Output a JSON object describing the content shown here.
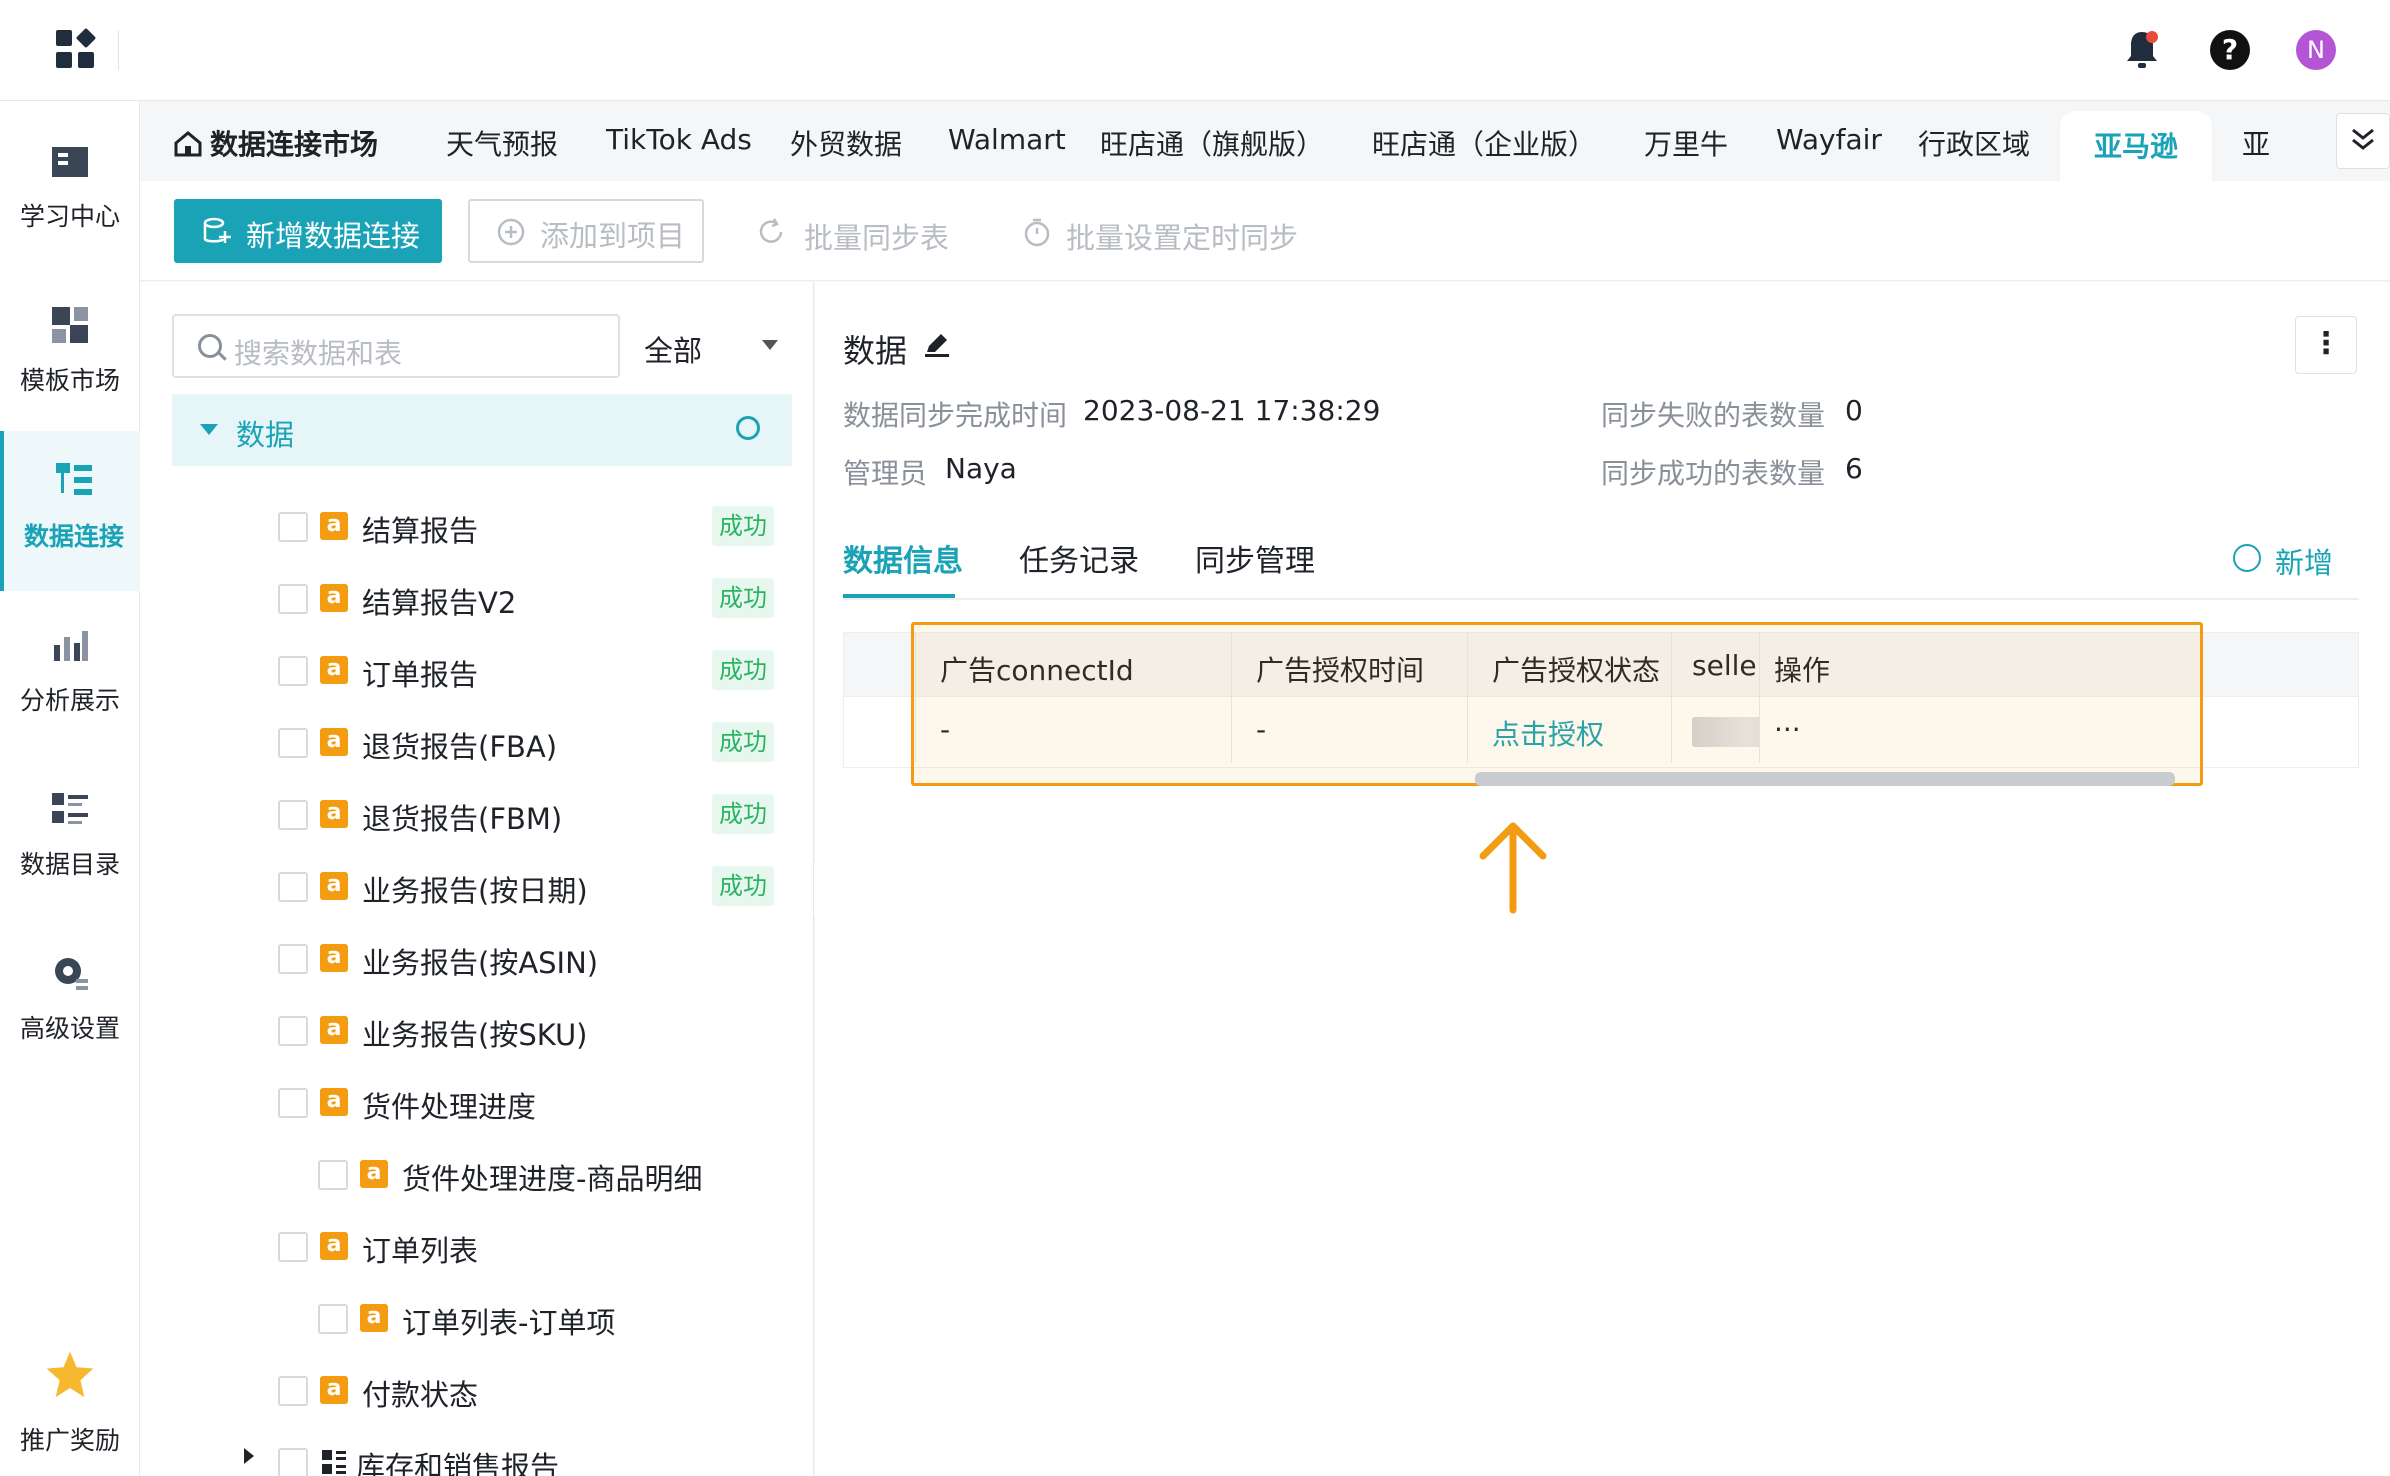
{
  "header": {
    "avatar_initial": "N"
  },
  "leftnav": [
    {
      "label": "学习中心",
      "icon": "book-icon"
    },
    {
      "label": "模板市场",
      "icon": "template-icon"
    },
    {
      "label": "数据连接",
      "icon": "data-connect-icon",
      "active": true
    },
    {
      "label": "分析展示",
      "icon": "chart-icon"
    },
    {
      "label": "数据目录",
      "icon": "catalog-icon"
    },
    {
      "label": "高级设置",
      "icon": "settings-icon"
    },
    {
      "label": "推广奖励",
      "icon": "star-icon"
    }
  ],
  "tabs": [
    "数据连接市场",
    "天气预报",
    "TikTok Ads",
    "外贸数据",
    "Walmart",
    "旺店通（旗舰版）",
    "旺店通（企业版）",
    "万里牛",
    "Wayfair",
    "行政区域",
    "亚马逊",
    "亚"
  ],
  "toolbar": {
    "new_connection": "新增数据连接",
    "add_to_project": "添加到项目",
    "batch_sync": "批量同步表",
    "batch_schedule": "批量设置定时同步"
  },
  "tree": {
    "search_placeholder": "搜索数据和表",
    "filter": "全部",
    "root": "数据",
    "items": [
      {
        "label": "结算报告",
        "status": "成功"
      },
      {
        "label": "结算报告V2",
        "status": "成功"
      },
      {
        "label": "订单报告",
        "status": "成功"
      },
      {
        "label": "退货报告(FBA)",
        "status": "成功"
      },
      {
        "label": "退货报告(FBM)",
        "status": "成功"
      },
      {
        "label": "业务报告(按日期)",
        "status": "成功"
      },
      {
        "label": "业务报告(按ASIN)"
      },
      {
        "label": "业务报告(按SKU)"
      },
      {
        "label": "货件处理进度"
      },
      {
        "label": "货件处理进度-商品明细"
      },
      {
        "label": "订单列表"
      },
      {
        "label": "订单列表-订单项"
      },
      {
        "label": "付款状态"
      },
      {
        "label": "库存和销售报告"
      }
    ]
  },
  "detail": {
    "title": "数据",
    "sync_time_label": "数据同步完成时间",
    "sync_time": "2023-08-21 17:38:29",
    "fail_label": "同步失败的表数量",
    "fail_count": "0",
    "admin_label": "管理员",
    "admin": "Naya",
    "success_label": "同步成功的表数量",
    "success_count": "6",
    "tabs": [
      "数据信息",
      "任务记录",
      "同步管理"
    ],
    "add_label": "新增",
    "table": {
      "headers": [
        "广告connectId",
        "广告授权时间",
        "广告授权状态",
        "sellerId",
        "操作"
      ],
      "row": [
        "-",
        "-",
        "点击授权",
        "",
        "···"
      ]
    }
  },
  "colors": {
    "accent": "#1aa3b6",
    "highlight": "#f39c12",
    "success": "#28b463"
  }
}
